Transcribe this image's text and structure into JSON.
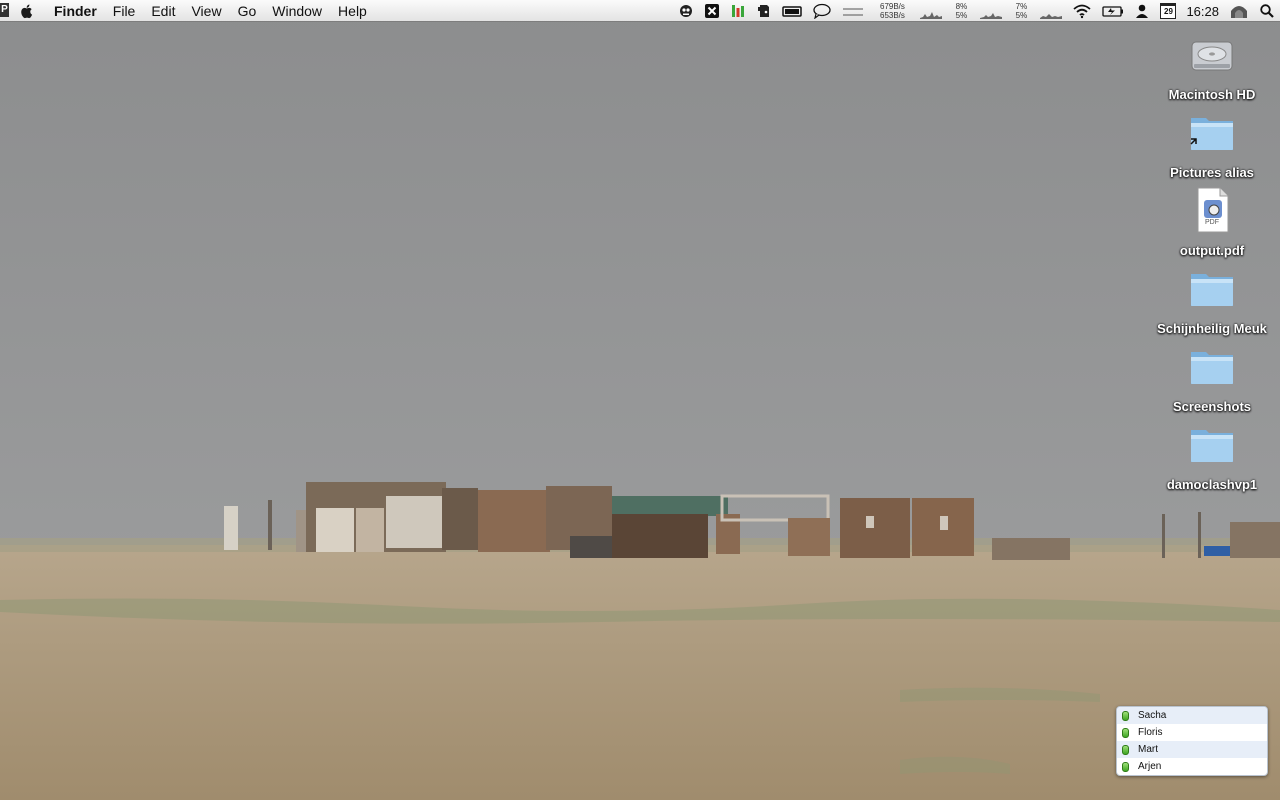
{
  "menubar": {
    "badge": "P",
    "apple_icon": "apple-logo-icon",
    "menus": [
      "Finder",
      "File",
      "Edit",
      "View",
      "Go",
      "Window",
      "Help"
    ],
    "status_icons": [
      "robot-icon",
      "x-box-icon",
      "bar-meter-icon",
      "evernote-icon",
      "battery-bar-icon",
      "chat-bubble-icon",
      "dashes-icon"
    ],
    "net_up": "679B/s",
    "net_down": "653B/s",
    "cpu1_top": "8%",
    "cpu1_bottom": "5%",
    "cpu2_top": "7%",
    "cpu2_bottom": "5%",
    "calendar_day": "29",
    "clock": "16:28"
  },
  "desktop": {
    "icons": [
      {
        "label": "Macintosh HD",
        "type": "hard-drive-icon"
      },
      {
        "label": "Pictures alias",
        "type": "folder-alias-icon"
      },
      {
        "label": "output.pdf",
        "type": "pdf-file-icon"
      },
      {
        "label": "Schijnheilig Meuk",
        "type": "folder-icon"
      },
      {
        "label": "Screenshots",
        "type": "folder-icon"
      },
      {
        "label": "damoclashvp1",
        "type": "folder-icon"
      }
    ],
    "pdf_tag": "PDF"
  },
  "buddy_list": {
    "buddies": [
      "Sacha",
      "Floris",
      "Mart",
      "Arjen"
    ],
    "status_color": "#4cb52a"
  }
}
